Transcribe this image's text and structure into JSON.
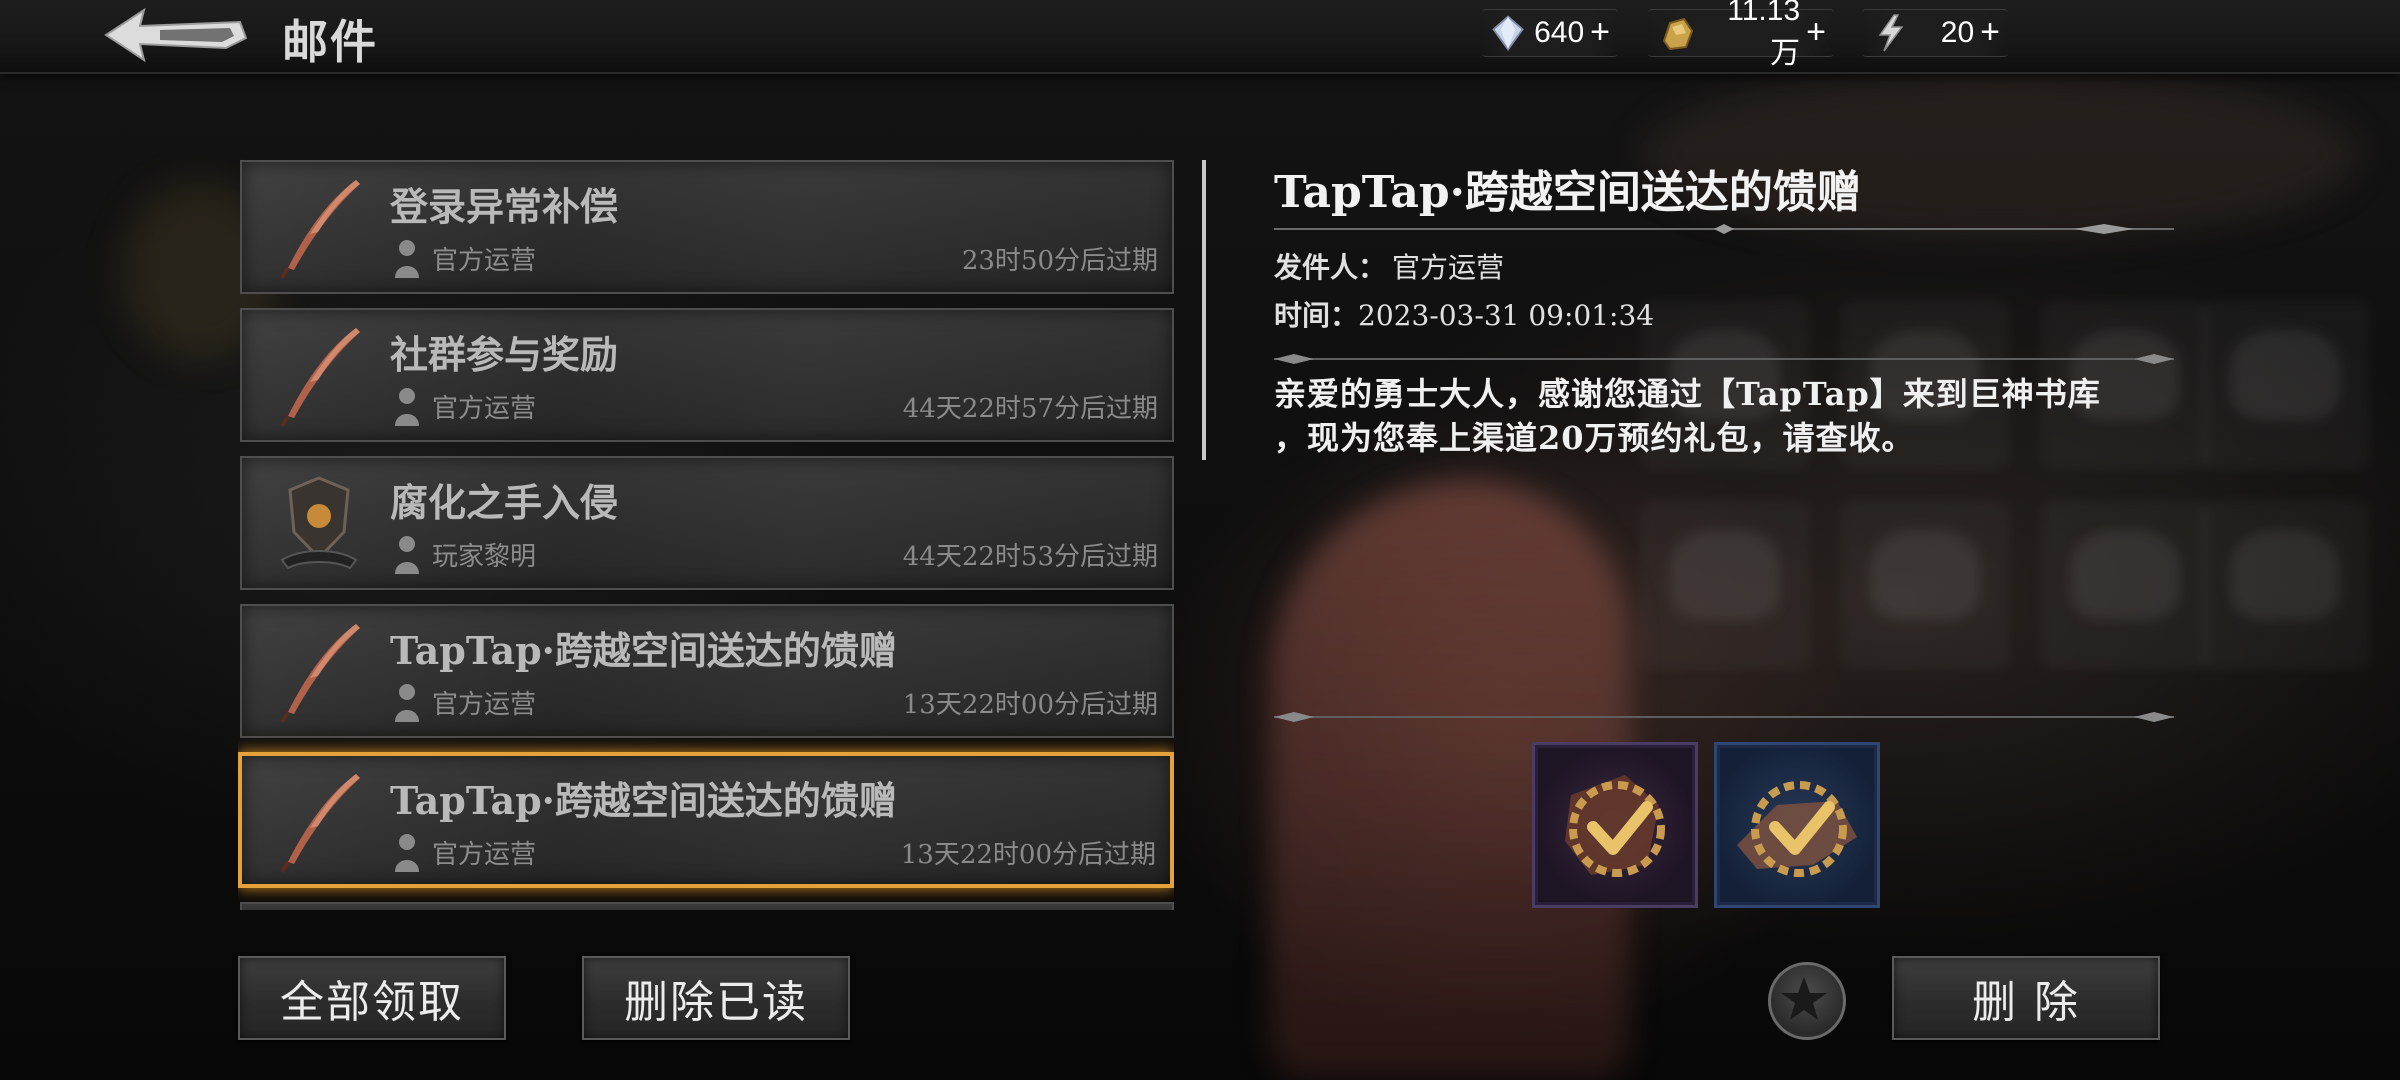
{
  "header": {
    "title": "邮件",
    "currencies": [
      {
        "icon": "diamond-icon",
        "value": "640",
        "plus": "+"
      },
      {
        "icon": "gold-nugget-icon",
        "value": "11.13万",
        "plus": "+"
      },
      {
        "icon": "lightning-stamina-icon",
        "value": "20",
        "plus": "+"
      }
    ]
  },
  "mails": [
    {
      "title": "登录异常补偿",
      "sender": "官方运营",
      "expire": "23时50分后过期",
      "icon": "feather-quill-icon",
      "selected": false
    },
    {
      "title": "社群参与奖励",
      "sender": "官方运营",
      "expire": "44天22时57分后过期",
      "icon": "feather-quill-icon",
      "selected": false
    },
    {
      "title": "腐化之手入侵",
      "sender": "玩家黎明",
      "expire": "44天22时53分后过期",
      "icon": "guild-shield-icon",
      "selected": false
    },
    {
      "title": "TapTap·跨越空间送达的馈赠",
      "sender": "官方运营",
      "expire": "13天22时00分后过期",
      "icon": "feather-quill-icon",
      "selected": false
    },
    {
      "title": "TapTap·跨越空间送达的馈赠",
      "sender": "官方运营",
      "expire": "13天22时00分后过期",
      "icon": "feather-quill-icon",
      "selected": true
    }
  ],
  "detail": {
    "title": "TapTap·跨越空间送达的馈赠",
    "sender_label": "发件人：",
    "sender": "官方运营",
    "time_label": "时间：",
    "time": "2023-03-31 09:01:34",
    "body_lines": [
      "亲爱的勇士大人，感谢您通过【TapTap】来到巨神书库",
      "，现为您奉上渠道20万预约礼包，请查收。"
    ],
    "attachments": [
      {
        "icon": "claimed-gem-icon",
        "rarity_color": "#4a3c62",
        "claimed": true
      },
      {
        "icon": "claimed-ore-icon",
        "rarity_color": "#2f4670",
        "claimed": true
      }
    ]
  },
  "buttons": {
    "claim_all": "全部领取",
    "delete_read": "删除已读",
    "delete": "删 除"
  },
  "colors": {
    "selected_border": "#e5a23a",
    "panel_text": "#f2f2f2"
  }
}
